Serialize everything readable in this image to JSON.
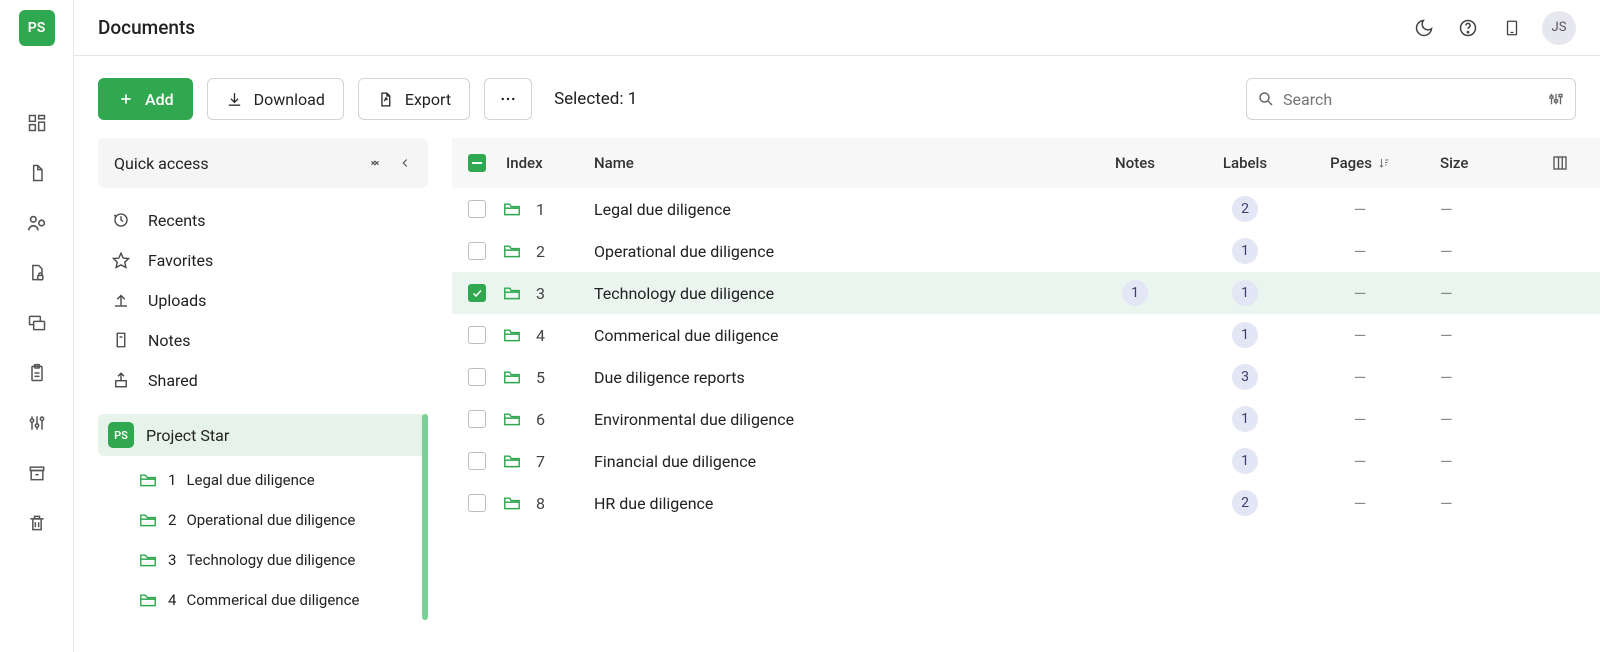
{
  "project_badge": "PS",
  "header": {
    "title": "Documents",
    "avatar": "JS"
  },
  "toolbar": {
    "add": "Add",
    "download": "Download",
    "export": "Export",
    "selected_label": "Selected:",
    "selected_count": "1",
    "search_placeholder": "Search"
  },
  "sidebar": {
    "quick_access_label": "Quick access",
    "items": [
      {
        "label": "Recents"
      },
      {
        "label": "Favorites"
      },
      {
        "label": "Uploads"
      },
      {
        "label": "Notes"
      },
      {
        "label": "Shared"
      }
    ],
    "tree": {
      "root_badge": "PS",
      "root_label": "Project Star",
      "children": [
        {
          "index": "1",
          "label": "Legal due diligence"
        },
        {
          "index": "2",
          "label": "Operational due diligence"
        },
        {
          "index": "3",
          "label": "Technology due diligence"
        },
        {
          "index": "4",
          "label": "Commerical due diligence"
        }
      ]
    }
  },
  "table": {
    "headers": {
      "index": "Index",
      "name": "Name",
      "notes": "Notes",
      "labels": "Labels",
      "pages": "Pages",
      "size": "Size"
    },
    "rows": [
      {
        "index": "1",
        "name": "Legal due diligence",
        "notes": "",
        "labels": "2",
        "pages": "—",
        "size": "—",
        "selected": false
      },
      {
        "index": "2",
        "name": "Operational due diligence",
        "notes": "",
        "labels": "1",
        "pages": "—",
        "size": "—",
        "selected": false
      },
      {
        "index": "3",
        "name": "Technology due diligence",
        "notes": "1",
        "labels": "1",
        "pages": "—",
        "size": "—",
        "selected": true
      },
      {
        "index": "4",
        "name": "Commerical due diligence",
        "notes": "",
        "labels": "1",
        "pages": "—",
        "size": "—",
        "selected": false
      },
      {
        "index": "5",
        "name": "Due diligence reports",
        "notes": "",
        "labels": "3",
        "pages": "—",
        "size": "—",
        "selected": false
      },
      {
        "index": "6",
        "name": "Environmental due diligence",
        "notes": "",
        "labels": "1",
        "pages": "—",
        "size": "—",
        "selected": false
      },
      {
        "index": "7",
        "name": "Financial due diligence",
        "notes": "",
        "labels": "1",
        "pages": "—",
        "size": "—",
        "selected": false
      },
      {
        "index": "8",
        "name": "HR due diligence",
        "notes": "",
        "labels": "2",
        "pages": "—",
        "size": "—",
        "selected": false
      }
    ]
  }
}
